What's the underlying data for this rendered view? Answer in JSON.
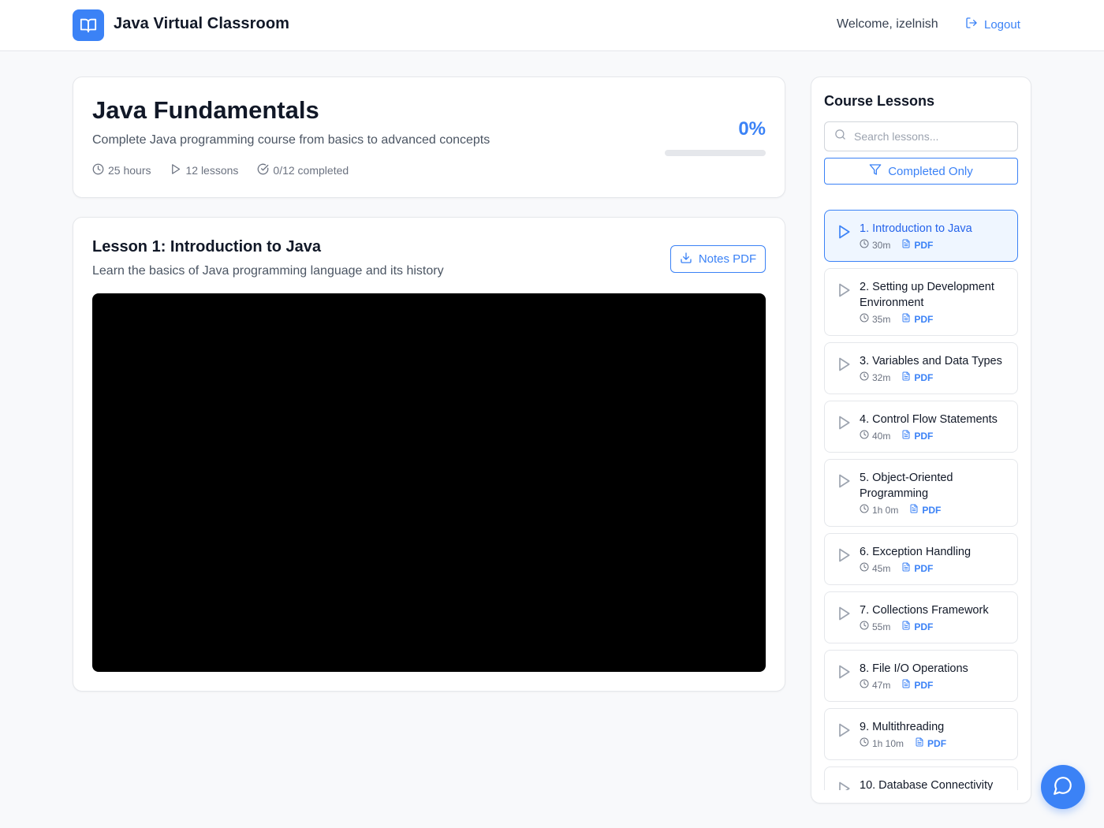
{
  "header": {
    "app_title": "Java Virtual Classroom",
    "welcome": "Welcome, izelnish",
    "logout_label": "Logout"
  },
  "course": {
    "title": "Java Fundamentals",
    "description": "Complete Java programming course from basics to advanced concepts",
    "hours": "25 hours",
    "lessons": "12 lessons",
    "completed": "0/12 completed",
    "progress_label": "0%",
    "progress_fraction": 0
  },
  "current_lesson": {
    "title": "Lesson 1: Introduction to Java",
    "description": "Learn the basics of Java programming language and its history",
    "notes_label": "Notes PDF"
  },
  "sidebar": {
    "title": "Course Lessons",
    "search_placeholder": "Search lessons...",
    "filter_label": "Completed Only",
    "pdf_label": "PDF",
    "items": [
      {
        "label": "1. Introduction to Java",
        "duration": "30m",
        "active": true
      },
      {
        "label": "2. Setting up Development Environment",
        "duration": "35m",
        "active": false
      },
      {
        "label": "3. Variables and Data Types",
        "duration": "32m",
        "active": false
      },
      {
        "label": "4. Control Flow Statements",
        "duration": "40m",
        "active": false
      },
      {
        "label": "5. Object-Oriented Programming",
        "duration": "1h 0m",
        "active": false
      },
      {
        "label": "6. Exception Handling",
        "duration": "45m",
        "active": false
      },
      {
        "label": "7. Collections Framework",
        "duration": "55m",
        "active": false
      },
      {
        "label": "8. File I/O Operations",
        "duration": "47m",
        "active": false
      },
      {
        "label": "9. Multithreading",
        "duration": "1h 10m",
        "active": false
      },
      {
        "label": "10. Database Connectivity",
        "duration": "",
        "active": false
      }
    ]
  },
  "colors": {
    "accent": "#3b82f6",
    "background": "#f8f9fb",
    "video": "#000000"
  }
}
